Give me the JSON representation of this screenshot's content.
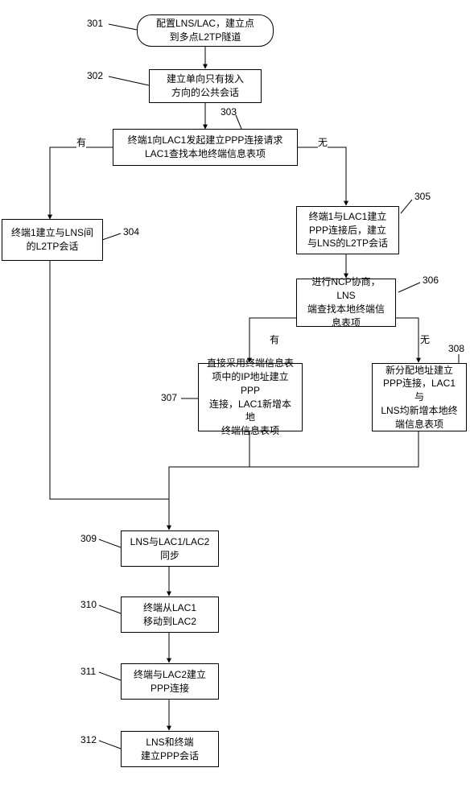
{
  "nodes": {
    "n301": "配置LNS/LAC，建立点\n到多点L2TP隧道",
    "n302": "建立单向只有拨入\n方向的公共会话",
    "n303": "终端1向LAC1发起建立PPP连接请求\nLAC1查找本地终端信息表项",
    "n304": "终端1建立与LNS间\n的L2TP会话",
    "n305": "终端1与LAC1建立\nPPP连接后，建立\n与LNS的L2TP会话",
    "n306": "进行NCP协商，LNS\n端查找本地终端信\n息表项",
    "n307": "直接采用终端信息表\n项中的IP地址建立PPP\n连接，LAC1新增本地\n终端信息表项",
    "n308": "新分配地址建立\nPPP连接，LAC1与\nLNS均新增本地终\n端信息表项",
    "n309": "LNS与LAC1/LAC2\n同步",
    "n310": "终端从LAC1\n移动到LAC2",
    "n311": "终端与LAC2建立\nPPP连接",
    "n312": "LNS和终端\n建立PPP会话"
  },
  "nums": {
    "l301": "301",
    "l302": "302",
    "l303": "303",
    "l304": "304",
    "l305": "305",
    "l306": "306",
    "l307": "307",
    "l308": "308",
    "l309": "309",
    "l310": "310",
    "l311": "311",
    "l312": "312"
  },
  "edges": {
    "yes": "有",
    "no": "无"
  }
}
